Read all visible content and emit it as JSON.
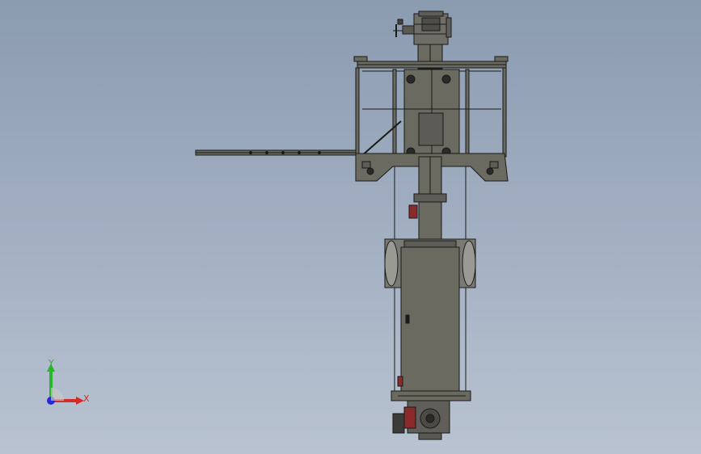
{
  "viewport": {
    "background_top": "#8b9bb0",
    "background_bottom": "#b9c3d1"
  },
  "model": {
    "part_color": "#6b6a60",
    "edge_color": "#1a1a1a",
    "motor_accent": "#8a2a2a",
    "structure": [
      "top-gearmotor",
      "top-frame",
      "side-arm-rail",
      "central-column",
      "valve-flange",
      "main-cabinet",
      "bottom-gearmotor"
    ]
  },
  "triad": {
    "x_label": "X",
    "y_label": "Y",
    "x_color": "#d42a2a",
    "y_color": "#2ab52a",
    "z_color": "#2a2ad4"
  }
}
